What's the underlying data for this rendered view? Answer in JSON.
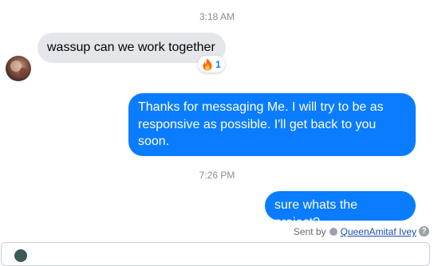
{
  "conversation": {
    "timestamps": [
      "3:18 AM",
      "7:26 PM"
    ],
    "incoming_message": {
      "text": "wassup can we work together",
      "reaction": {
        "icon": "fire-icon",
        "count": "1"
      }
    },
    "outgoing_messages": [
      "Thanks for messaging Me. I will try to be as responsive as possible. I'll get back to you soon.",
      "sure whats the project?"
    ],
    "sent_by": {
      "prefix": "Sent by",
      "sender": "QueenAmitaf Ivey",
      "help_glyph": "?"
    }
  },
  "colors": {
    "outgoing_bubble": "#0a7cff",
    "incoming_bubble": "#e4e6eb",
    "timestamp_text": "#8a8d91",
    "reaction_count": "#0a7cff"
  }
}
